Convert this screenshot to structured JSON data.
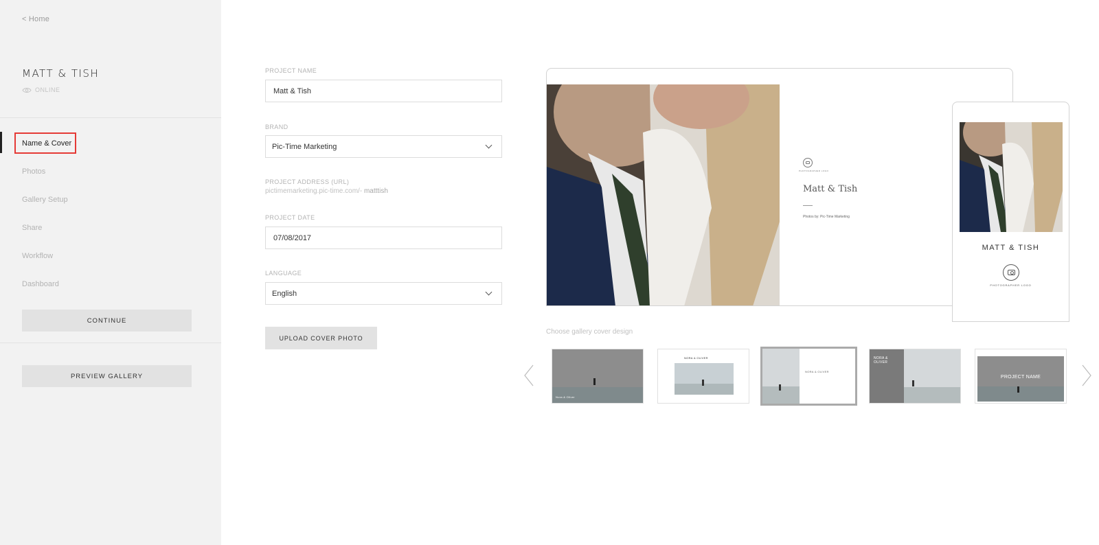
{
  "sidebar": {
    "home_link": "< Home",
    "project_title": "MATT & TISH",
    "status": "ONLINE",
    "nav": [
      {
        "label": "Name & Cover"
      },
      {
        "label": "Photos"
      },
      {
        "label": "Gallery Setup"
      },
      {
        "label": "Share"
      },
      {
        "label": "Workflow"
      },
      {
        "label": "Dashboard"
      }
    ],
    "continue_label": "CONTINUE",
    "preview_label": "PREVIEW GALLERY"
  },
  "form": {
    "project_name_label": "PROJECT NAME",
    "project_name_value": "Matt & Tish",
    "brand_label": "BRAND",
    "brand_value": "Pic-Time Marketing",
    "url_label": "PROJECT ADDRESS (URL)",
    "url_prefix": "pictimemarketing.pic-time.com/-",
    "url_slug": "matttish",
    "date_label": "PROJECT DATE",
    "date_value": "07/08/2017",
    "language_label": "LANGUAGE",
    "language_value": "English",
    "upload_label": "UPLOAD COVER PHOTO"
  },
  "preview": {
    "desktop_logo_caption": "PHOTOGRAPHER LOGO",
    "desktop_name": "Matt & Tish",
    "desktop_credit": "Photos by: Pic-Time Marketing",
    "mobile_name": "MATT & TISH",
    "mobile_logo_caption": "PHOTOGRAPHER LOGO"
  },
  "covers": {
    "label": "Choose gallery cover design",
    "thumb1_text": "Nora & Oliver",
    "thumb2_text": "NORA & OLIVER",
    "thumb3_text": "NORA & OLIVER",
    "thumb4_text": "NORA & OLIVER",
    "thumb5_text": "PROJECT NAME"
  },
  "colors": {
    "sidebar_bg": "#f2f2f2",
    "button_bg": "#e2e2e2",
    "highlight": "#e53935"
  }
}
